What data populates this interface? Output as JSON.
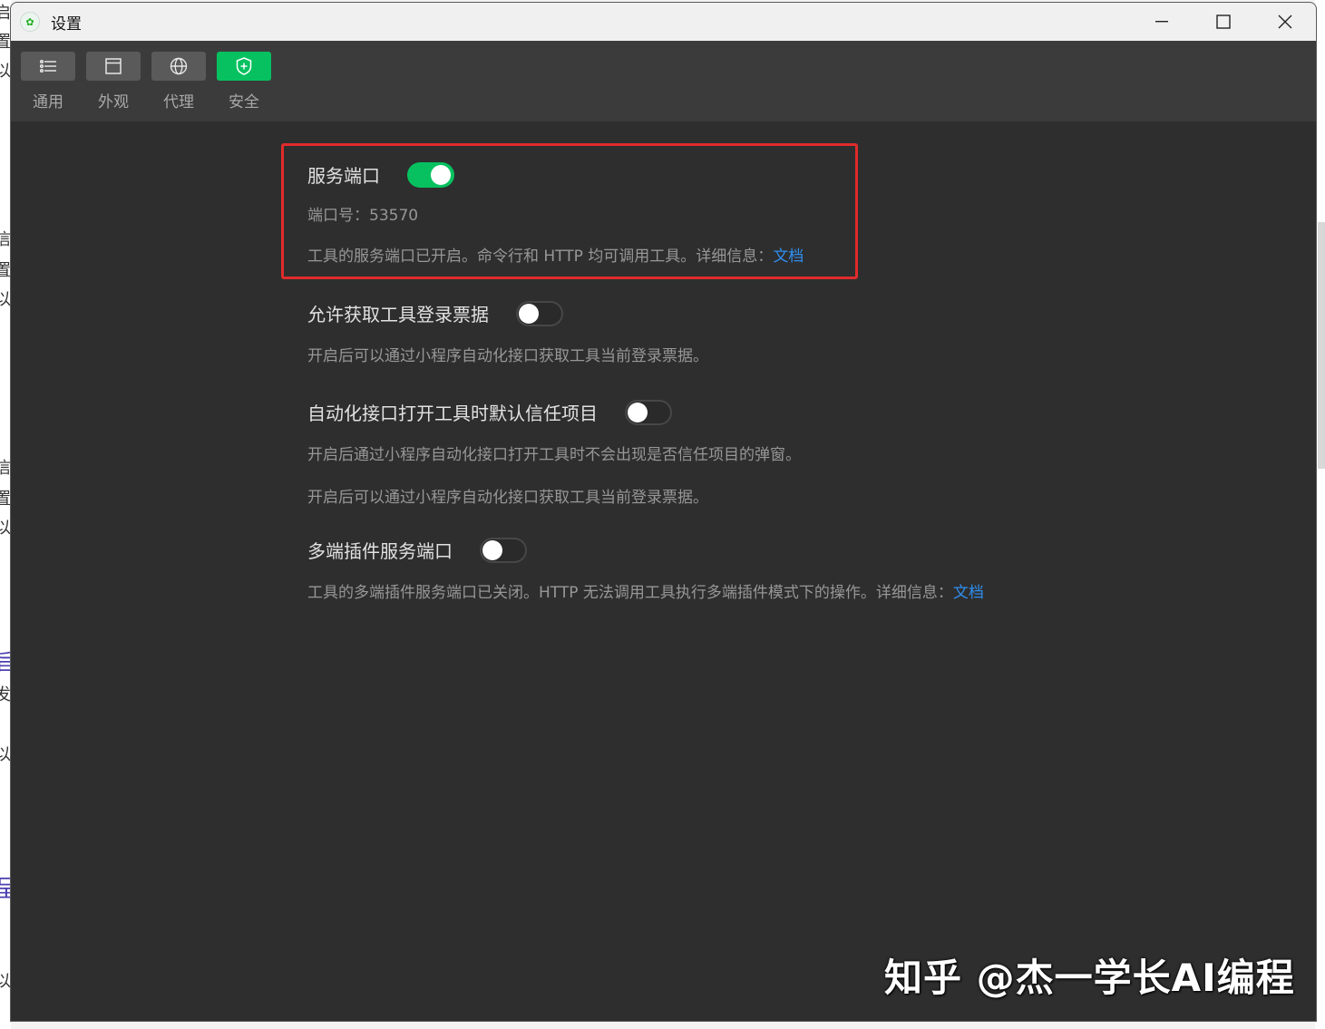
{
  "window": {
    "title": "设置"
  },
  "toolbar": {
    "tabs": [
      {
        "label": "通用",
        "icon": "list-icon"
      },
      {
        "label": "外观",
        "icon": "window-icon"
      },
      {
        "label": "代理",
        "icon": "globe-icon"
      },
      {
        "label": "安全",
        "icon": "shield-icon",
        "active": true
      }
    ]
  },
  "settings": {
    "service_port": {
      "title": "服务端口",
      "enabled": true,
      "port_line": "端口号：53570",
      "desc": "工具的服务端口已开启。命令行和 HTTP 均可调用工具。详细信息：",
      "link": "文档"
    },
    "allow_ticket": {
      "title": "允许获取工具登录票据",
      "enabled": false,
      "desc": "开启后可以通过小程序自动化接口获取工具当前登录票据。"
    },
    "auto_trust": {
      "title": "自动化接口打开工具时默认信任项目",
      "enabled": false,
      "desc1": "开启后通过小程序自动化接口打开工具时不会出现是否信任项目的弹窗。",
      "desc2": "开启后可以通过小程序自动化接口获取工具当前登录票据。"
    },
    "multi_plugin": {
      "title": "多端插件服务端口",
      "enabled": false,
      "desc": "工具的多端插件服务端口已关闭。HTTP 无法调用工具执行多端插件模式下的操作。详细信息：",
      "link": "文档"
    }
  },
  "watermark": "知乎 @杰一学长AI编程",
  "colors": {
    "accent": "#07c160",
    "link": "#2f8ef0",
    "highlight": "#e12b2b"
  }
}
